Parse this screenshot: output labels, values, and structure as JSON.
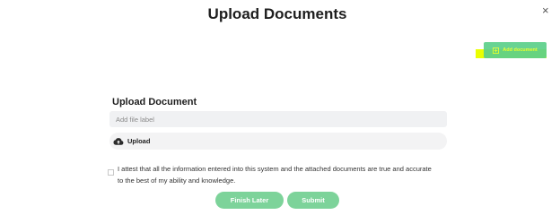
{
  "modal": {
    "title": "Upload Documents",
    "close_glyph": "×"
  },
  "toolbar": {
    "add_document_label": "Add document",
    "add_document_icon": "plus-square-icon",
    "accent_color": "#5cd08a",
    "highlight_color": "#eaff00"
  },
  "form": {
    "section_title": "Upload Document",
    "file_label_placeholder": "Add file label",
    "file_label_value": "",
    "upload_label": "Upload",
    "upload_icon": "cloud-upload-icon",
    "attestation_text": "I attest that all the information entered into this system and the attached documents are true and accurate to the best of my ability and knowledge.",
    "attestation_checked": false
  },
  "actions": {
    "finish_later_label": "Finish Later",
    "submit_label": "Submit",
    "button_color": "#7dd39a"
  }
}
